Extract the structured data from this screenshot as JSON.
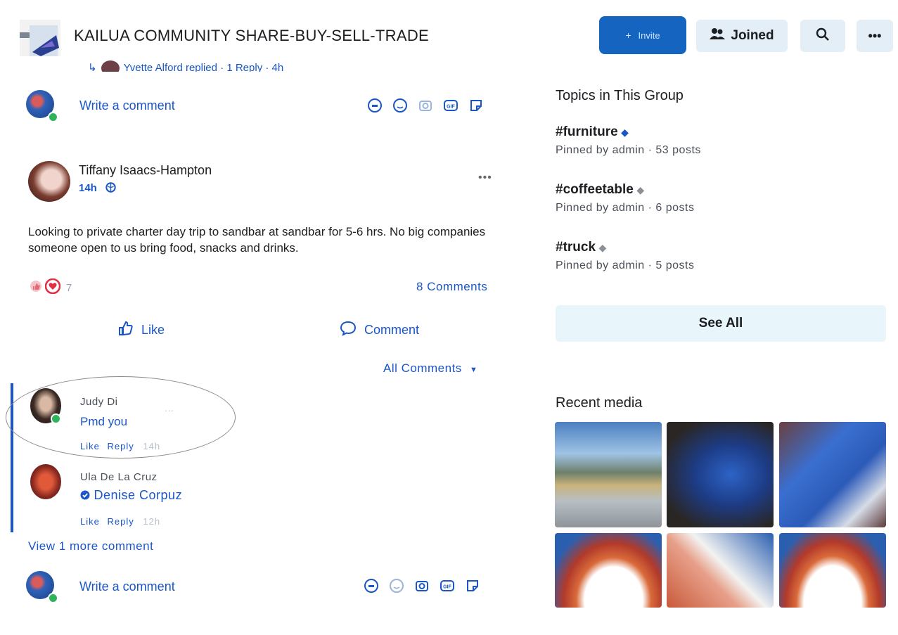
{
  "header": {
    "group_title": "KAILUA COMMUNITY SHARE-BUY-SELL-TRADE",
    "invite_label": "Invite",
    "joined_label": "Joined",
    "more_label": "•••"
  },
  "thread_top": {
    "reply_line_name": "Yvette Alford replied",
    "reply_line_count": "· 1 Reply · 4h"
  },
  "composer": {
    "placeholder": "Write a comment"
  },
  "post": {
    "author": "Tiffany Isaacs-Hampton",
    "time": "14h",
    "more": "•••",
    "body": "Looking to private charter day trip to sandbar at sandbar for 5-6 hrs. No big companies someone open to us bring food, snacks and drinks.",
    "reaction_count": "7",
    "comments_count": "8 Comments",
    "like_label": "Like",
    "comment_label": "Comment",
    "all_comments_label": "All Comments"
  },
  "comments": [
    {
      "name": "Judy Di",
      "text": "Pmd you",
      "like": "Like",
      "reply": "Reply",
      "time": "14h",
      "more": "···"
    },
    {
      "name": "Ula De La Cruz",
      "mention": "Denise Corpuz",
      "like": "Like",
      "reply": "Reply",
      "time": "12h"
    }
  ],
  "view_more": "View 1 more comment",
  "topics": {
    "title": "Topics in This Group",
    "items": [
      {
        "tag": "#furniture",
        "meta": "Pinned by admin · 53 posts"
      },
      {
        "tag": "#coffeetable",
        "meta": "Pinned by admin · 6 posts"
      },
      {
        "tag": "#truck",
        "meta": "Pinned by admin · 5 posts"
      }
    ],
    "see_all": "See All"
  },
  "recent_media": {
    "title": "Recent media"
  },
  "colors": {
    "accent": "#1a56c7",
    "primary_button": "#1565c0",
    "secondary_button": "#e4eef6",
    "see_all_bg": "#e8f5fa"
  }
}
